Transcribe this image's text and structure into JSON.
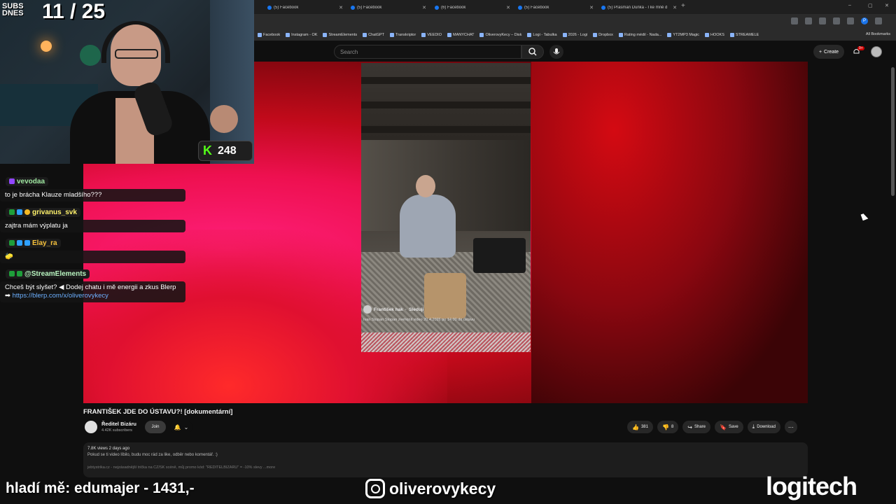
{
  "browser": {
    "tabs": [
      {
        "label": "(5) Facebook"
      },
      {
        "label": "(5) Facebook"
      },
      {
        "label": "(6) Facebook"
      },
      {
        "label": "(5) Facebook"
      },
      {
        "label": "(5) Prasman Dunka - I ke mně d"
      }
    ],
    "bookmarks": [
      "Facebook",
      "Instagram - OK",
      "StreamElements",
      "ChatGPT",
      "Transkriptor",
      "VEEDIO",
      "MANYCHAT",
      "OliverovyKecy – Disk",
      "Logi - Tabulka",
      "2026 - Logi",
      "Dropbox",
      "Rating médií - Nada...",
      "YT2MP3 Magic",
      "HOOKS",
      "STREAMELE"
    ],
    "all_bookmarks": "All Bookmarks",
    "profile_letter": "P"
  },
  "youtube": {
    "search_placeholder": "Search",
    "create_label": "Create",
    "notif_count": "9+",
    "video_title": "FRANTIŠEK JDE DO ÚSTAVU?! [dokumentární]",
    "channel_name": "Ředitel Bizáru",
    "channel_subs": "4.42K subscribers",
    "join_label": "Join",
    "like_count": "381",
    "dislike_count": "8",
    "share_label": "Share",
    "save_label": "Save",
    "download_label": "Download",
    "views_meta": "7.8K views  2 days ago",
    "desc_line1": "Pokud se ti video líbilo, budu moc rád za like, odběr nebo komentář. :)",
    "desc_line2": "jebtystrika.cz - nejzásadnější trička na CZ/SK scéně, můj promo kód: \"REDITELBIZARU\" = -10% slevy  ...more",
    "fb_overlay_name": "František hak",
    "fb_overlay_follow": "Sleduji",
    "fb_overlay_desc": "Ivan Stopan Stopan zveřejnil video 20.4.2026 po 14:00 do ústavu"
  },
  "stream": {
    "subs_label_1": "SUBS",
    "subs_label_2": "DNES",
    "subs_count": "11 / 25",
    "k_count": "248",
    "chat": [
      {
        "user": "vevodaa",
        "text": "to je brácha Klauze mladšího???",
        "color": "#9ee6a0",
        "badges": [
          "b-purple"
        ]
      },
      {
        "user": "grivanus_svk",
        "text": "zajtra mám výplatu ja",
        "color": "#fff26b",
        "badges": [
          "b-k",
          "b-blue",
          "b-gold"
        ]
      },
      {
        "user": "Elay_ra",
        "text": "🧽",
        "color": "#f7c23c",
        "badges": [
          "b-k",
          "b-blue",
          "b-blue"
        ]
      },
      {
        "user": "@StreamElements",
        "text": "Chceš být slyšet? ◀ Dodej chatu i mě energii a zkus Blerp ➡",
        "link": "https://blerp.com/x/oliverovykecy",
        "color": "#b8f5c0",
        "badges": [
          "b-k",
          "b-k"
        ]
      }
    ],
    "donor_text": "hladí mě: edumajer - 1431,-",
    "instagram": "oliverovykecy",
    "sponsor": "logitech"
  }
}
